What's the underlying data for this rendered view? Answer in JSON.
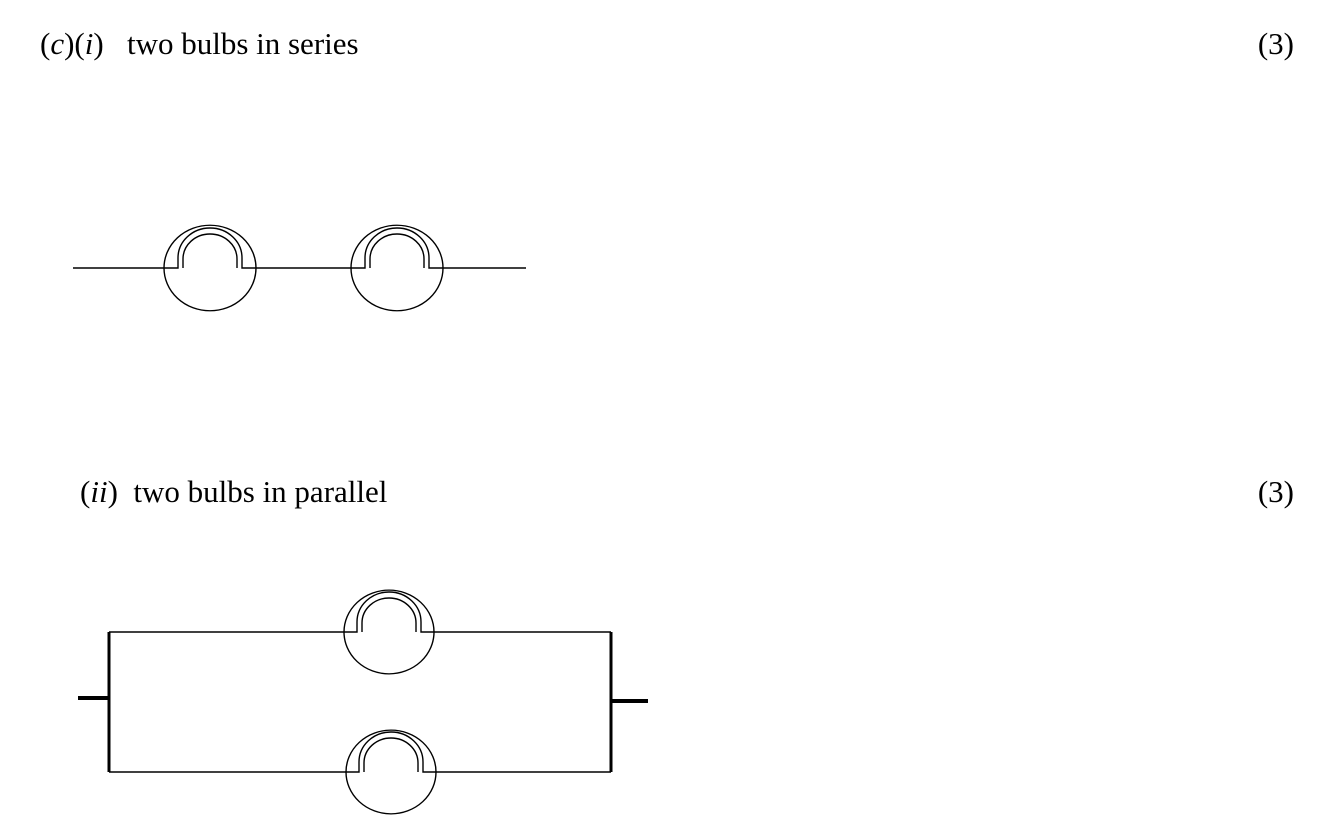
{
  "part_c": {
    "label_open": "(",
    "label_c": "c",
    "label_mid": ")(",
    "label_i": "i",
    "label_close": ")",
    "title": "two bulbs in series",
    "marks": "(3)"
  },
  "part_ii": {
    "label_open": "(",
    "label_ii": "ii",
    "label_close": ")",
    "title": "two bulbs in parallel",
    "marks": "(3)"
  }
}
